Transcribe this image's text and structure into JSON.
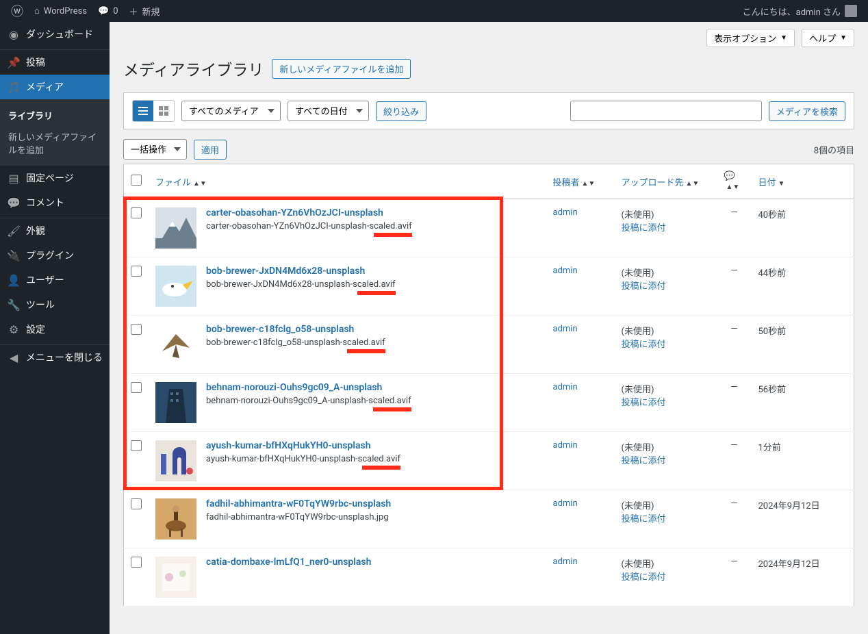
{
  "adminbar": {
    "site_name": "WordPress",
    "comments_count": "0",
    "new_label": "新規",
    "greeting": "こんにちは、admin さん"
  },
  "sidebar": {
    "dashboard": "ダッシュボード",
    "posts": "投稿",
    "media": "メディア",
    "media_sub": {
      "library": "ライブラリ",
      "add_new": "新しいメディアファイルを追加"
    },
    "pages": "固定ページ",
    "comments": "コメント",
    "appearance": "外観",
    "plugins": "プラグイン",
    "users": "ユーザー",
    "tools": "ツール",
    "settings": "設定",
    "collapse": "メニューを閉じる"
  },
  "top_actions": {
    "screen_options": "表示オプション",
    "help": "ヘルプ"
  },
  "page": {
    "title": "メディアライブラリ",
    "add_new_btn": "新しいメディアファイルを追加"
  },
  "filters": {
    "all_media": "すべてのメディア",
    "all_dates": "すべての日付",
    "filter_btn": "絞り込み",
    "search_btn": "メディアを検索",
    "search_placeholder": ""
  },
  "bulk": {
    "action": "一括操作",
    "apply": "適用",
    "count": "8個の項目"
  },
  "columns": {
    "file": "ファイル",
    "author": "投稿者",
    "uploaded_to": "アップロード先",
    "date": "日付"
  },
  "unused": "(未使用)",
  "attach": "投稿に添付",
  "dash": "—",
  "items": [
    {
      "title": "carter-obasohan-YZn6VhOzJCI-unsplash",
      "filename": "carter-obasohan-YZn6VhOzJCI-unsplash-scaled.avif",
      "author": "admin",
      "date": "40秒前",
      "thumb": "mountain"
    },
    {
      "title": "bob-brewer-JxDN4Md6x28-unsplash",
      "filename": "bob-brewer-JxDN4Md6x28-unsplash-scaled.avif",
      "author": "admin",
      "date": "44秒前",
      "thumb": "bird"
    },
    {
      "title": "bob-brewer-c18fclg_o58-unsplash",
      "filename": "bob-brewer-c18fclg_o58-unsplash-scaled.avif",
      "author": "admin",
      "date": "50秒前",
      "thumb": "eagle"
    },
    {
      "title": "behnam-norouzi-Ouhs9gc09_A-unsplash",
      "filename": "behnam-norouzi-Ouhs9gc09_A-unsplash-scaled.avif",
      "author": "admin",
      "date": "56秒前",
      "thumb": "building"
    },
    {
      "title": "ayush-kumar-bfHXqHukYH0-unsplash",
      "filename": "ayush-kumar-bfHXqHukYH0-unsplash-scaled.avif",
      "author": "admin",
      "date": "1分前",
      "thumb": "abstract"
    },
    {
      "title": "fadhil-abhimantra-wF0TqYW9rbc-unsplash",
      "filename": "fadhil-abhimantra-wF0TqYW9rbc-unsplash.jpg",
      "author": "admin",
      "date": "2024年9月12日",
      "thumb": "horseman"
    },
    {
      "title": "catia-dombaxe-lmLfQ1_ner0-unsplash",
      "filename": "",
      "author": "admin",
      "date": "2024年9月12日",
      "thumb": "light"
    }
  ],
  "highlight": {
    "first": 0,
    "last": 4
  }
}
